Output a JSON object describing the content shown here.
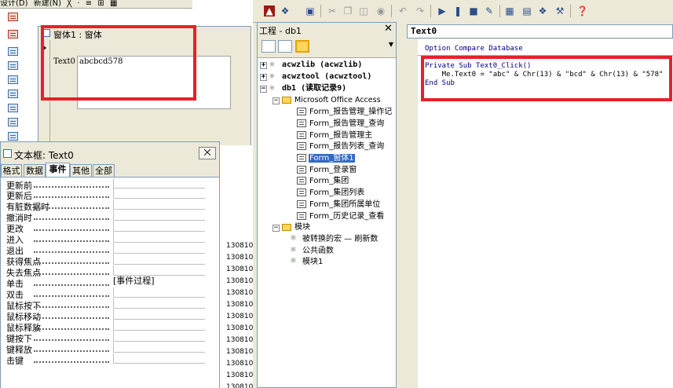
{
  "access_toolbar": {
    "items": [
      "设计(D)",
      "新建(N)",
      "╳",
      "·",
      "≡",
      "⊞",
      "▦"
    ]
  },
  "form_window": {
    "title": "窗体1 : 窗体",
    "text0_label": "Text0",
    "text0_value": "abcbcd578"
  },
  "background_numbers": [
    "130810",
    "130810",
    "130810",
    "130810",
    "130810",
    "130810",
    "130810",
    "130810",
    "130810",
    "130810",
    "130810",
    "130810",
    "130810"
  ],
  "property_sheet": {
    "title": "文本框: Text0",
    "close_label": "⨉",
    "tabs": [
      "格式",
      "数据",
      "事件",
      "其他",
      "全部"
    ],
    "active_tab": "事件",
    "rows": [
      {
        "label": "更新前",
        "value": ""
      },
      {
        "label": "更新后",
        "value": ""
      },
      {
        "label": "有脏数据时",
        "value": ""
      },
      {
        "label": "撤消时",
        "value": ""
      },
      {
        "label": "更改",
        "value": ""
      },
      {
        "label": "进入",
        "value": ""
      },
      {
        "label": "退出",
        "value": ""
      },
      {
        "label": "获得焦点",
        "value": ""
      },
      {
        "label": "失去焦点",
        "value": ""
      },
      {
        "label": "单击",
        "value": "[事件过程]"
      },
      {
        "label": "双击",
        "value": ""
      },
      {
        "label": "鼠标按下",
        "value": ""
      },
      {
        "label": "鼠标移动",
        "value": ""
      },
      {
        "label": "鼠标释放",
        "value": ""
      },
      {
        "label": "键按下",
        "value": ""
      },
      {
        "label": "键释放",
        "value": ""
      },
      {
        "label": "击键",
        "value": ""
      }
    ]
  },
  "vbe_toolbar": {
    "icons": [
      "access-icon",
      "insert-icon",
      "save-icon",
      "cut-icon",
      "copy-icon",
      "paste-icon",
      "find-icon",
      "undo-icon",
      "redo-icon",
      "run-icon",
      "break-icon",
      "reset-icon",
      "design-mode-icon",
      "project-explorer-icon",
      "properties-icon",
      "object-browser-icon",
      "toolbox-icon",
      "help-icon"
    ]
  },
  "project_pane": {
    "title": "工程 - db1",
    "close_label": "✕",
    "tree": [
      {
        "label": "acwzlib (acwzlib)",
        "level": 0,
        "type": "project",
        "expander": "+"
      },
      {
        "label": "acwztool (acwztool)",
        "level": 0,
        "type": "project",
        "expander": "+"
      },
      {
        "label": "db1 (读取记录9)",
        "level": 0,
        "type": "project",
        "expander": "−"
      },
      {
        "label": "Microsoft Office Access",
        "level": 1,
        "type": "folder",
        "expander": "−"
      },
      {
        "label": "Form_报告管理_操作记",
        "level": 2,
        "type": "form"
      },
      {
        "label": "Form_报告管理_查询",
        "level": 2,
        "type": "form"
      },
      {
        "label": "Form_报告管理主",
        "level": 2,
        "type": "form"
      },
      {
        "label": "Form_报告列表_查询",
        "level": 2,
        "type": "form"
      },
      {
        "label": "Form_窗体1",
        "level": 2,
        "type": "form",
        "selected": true
      },
      {
        "label": "Form_登录窗",
        "level": 2,
        "type": "form"
      },
      {
        "label": "Form_集团",
        "level": 2,
        "type": "form"
      },
      {
        "label": "Form_集团列表",
        "level": 2,
        "type": "form"
      },
      {
        "label": "Form_集团所属单位",
        "level": 2,
        "type": "form"
      },
      {
        "label": "Form_历史记录_查看",
        "level": 2,
        "type": "form"
      },
      {
        "label": "模块",
        "level": 1,
        "type": "folder",
        "expander": "−"
      },
      {
        "label": "被转换的宏 — 刷新数",
        "level": 2,
        "type": "module"
      },
      {
        "label": "公共函数",
        "level": 2,
        "type": "module"
      },
      {
        "label": "模块1",
        "level": 2,
        "type": "module"
      }
    ]
  },
  "code_window": {
    "object_combo": "Text0",
    "option_line": "Option Compare Database",
    "lines": [
      "Private Sub Text0_Click()",
      "    Me.Text0 = \"abc\" & Chr(13) & \"bcd\" & Chr(13) & \"578\"",
      "End Sub"
    ]
  },
  "highlight_color": "#e8202a"
}
